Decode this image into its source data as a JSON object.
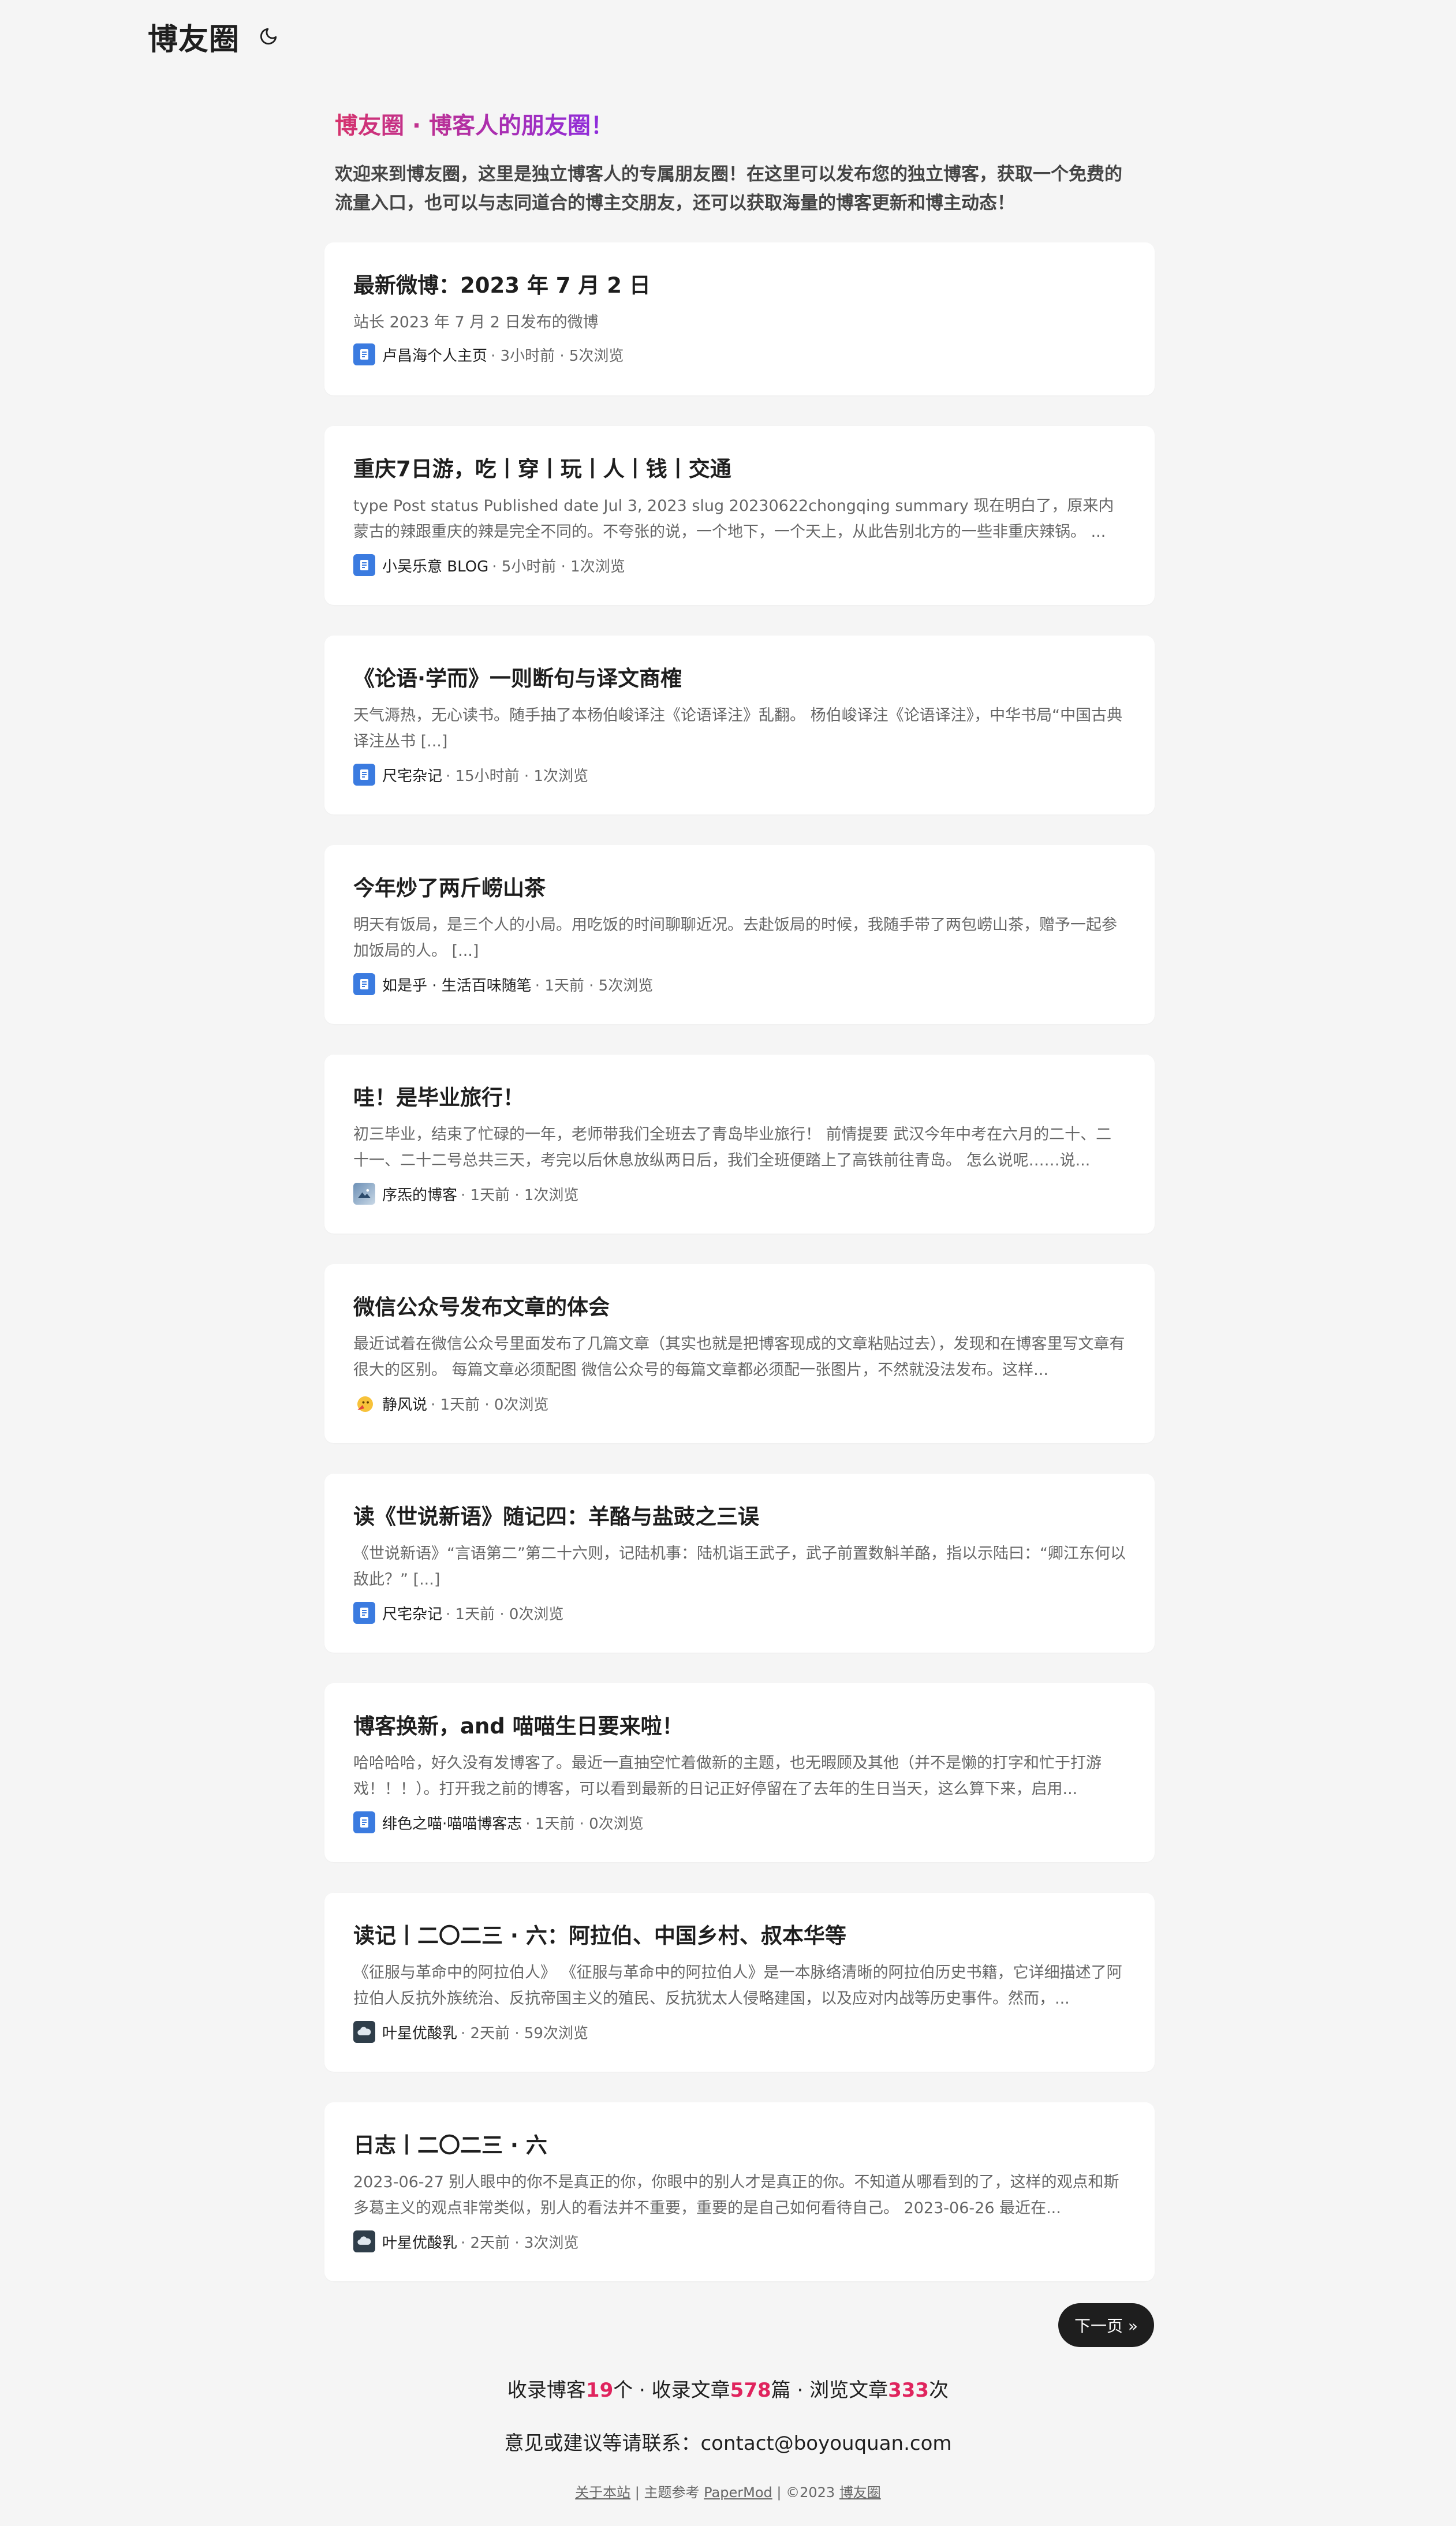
{
  "header": {
    "logo": "博友圈",
    "theme_icon": "moon-icon"
  },
  "intro": {
    "title": "博友圈 · 博客人的朋友圈！",
    "text": "欢迎来到博友圈，这里是独立博客人的专属朋友圈！在这里可以发布您的独立博客，获取一个免费的流量入口，也可以与志同道合的博主交朋友，还可以获取海量的博客更新和博主动态！",
    "gradient": [
      "#d6336c",
      "#8a2be2"
    ]
  },
  "posts": [
    {
      "title": "最新微博：2023 年 7 月 2 日",
      "summary": "站长 2023 年 7 月 2 日发布的微博",
      "blog": "卢昌海个人主页",
      "meta": "· 3小时前 · 5次浏览",
      "avatar": "blue-doc-icon"
    },
    {
      "title": "重庆7日游，吃丨穿丨玩丨人丨钱丨交通",
      "summary": "type Post status Published date Jul 3, 2023 slug 20230622chongqing summary 现在明白了，原来内蒙古的辣跟重庆的辣是完全不同的。不夸张的说，一个地下，一个天上，从此告别北方的一些非重庆辣锅。 ...",
      "blog": "小吴乐意 BLOG",
      "meta": "· 5小时前 · 1次浏览",
      "avatar": "blue-doc-icon"
    },
    {
      "title": "《论语·学而》一则断句与译文商榷",
      "summary": "天气溽热，无心读书。随手抽了本杨伯峻译注《论语译注》乱翻。 杨伯峻译注《论语译注》，中华书局“中国古典译注丛书 [...]",
      "blog": "尺宅杂记",
      "meta": "· 15小时前 · 1次浏览",
      "avatar": "blue-doc-icon"
    },
    {
      "title": "今年炒了两斤崂山茶",
      "summary": "明天有饭局，是三个人的小局。用吃饭的时间聊聊近况。去赴饭局的时候，我随手带了两包崂山茶，赠予一起参加饭局的人。 [...]",
      "blog": "如是乎 · 生活百味随笔",
      "meta": "· 1天前 · 5次浏览",
      "avatar": "blue-doc-icon"
    },
    {
      "title": "哇！是毕业旅行！",
      "summary": "初三毕业，结束了忙碌的一年，老师带我们全班去了青岛毕业旅行！ 前情提要 武汉今年中考在六月的二十、二十一、二十二号总共三天，考完以后休息放纵两日后，我们全班便踏上了高铁前往青岛。 怎么说呢……说...",
      "blog": "序炁的博客",
      "meta": "· 1天前 · 1次浏览",
      "avatar": "photo-icon"
    },
    {
      "title": "微信公众号发布文章的体会",
      "summary": "最近试着在微信公众号里面发布了几篇文章（其实也就是把博客现成的文章粘贴过去），发现和在博客里写文章有很大的区别。 每篇文章必须配图 微信公众号的每篇文章都必须配一张图片，不然就没法发布。这样...",
      "blog": "静风说",
      "meta": "· 1天前 · 0次浏览",
      "avatar": "emoji-icon"
    },
    {
      "title": "读《世说新语》随记四：羊酪与盐豉之三误",
      "summary": "《世说新语》“言语第二”第二十六则，记陆机事：陆机诣王武子，武子前置数斛羊酪，指以示陆曰：“卿江东何以敌此？” [...]",
      "blog": "尺宅杂记",
      "meta": "· 1天前 · 0次浏览",
      "avatar": "blue-doc-icon"
    },
    {
      "title": "博客换新，and 喵喵生日要来啦！",
      "summary": "哈哈哈哈，好久没有发博客了。最近一直抽空忙着做新的主题，也无暇顾及其他（并不是懒的打字和忙于打游戏！！！）。打开我之前的博客，可以看到最新的日记正好停留在了去年的生日当天，这么算下来，启用...",
      "blog": "绯色之喵·喵喵博客志",
      "meta": "· 1天前 · 0次浏览",
      "avatar": "blue-doc-icon"
    },
    {
      "title": "读记丨二〇二三 · 六：阿拉伯、中国乡村、叔本华等",
      "summary": "《征服与革命中的阿拉伯人》 《征服与革命中的阿拉伯人》是一本脉络清晰的阿拉伯历史书籍，它详细描述了阿拉伯人反抗外族统治、反抗帝国主义的殖民、反抗犹太人侵略建国，以及应对内战等历史事件。然而，...",
      "blog": "叶星优酸乳",
      "meta": "· 2天前 · 59次浏览",
      "avatar": "cloud-icon"
    },
    {
      "title": "日志丨二〇二三 · 六",
      "summary": "2023-06-27 别人眼中的你不是真正的你，你眼中的别人才是真正的你。不知道从哪看到的了，这样的观点和斯多葛主义的观点非常类似，别人的看法并不重要，重要的是自己如何看待自己。 2023-06-26 最近在...",
      "blog": "叶星优酸乳",
      "meta": "· 2天前 · 3次浏览",
      "avatar": "cloud-icon"
    }
  ],
  "pager": {
    "next_label": "下一页 »"
  },
  "stats": {
    "prefix1": "收录博客",
    "blogs": "19",
    "suffix1": "个 · 收录文章",
    "articles": "578",
    "suffix2": "篇 · 浏览文章",
    "views": "333",
    "suffix3": "次",
    "accent": "#e0245e"
  },
  "contact": {
    "text": "意见或建议等请联系：contact@boyouquan.com"
  },
  "footer": {
    "about": "关于本站",
    "sep1": " | 主题参考 ",
    "theme": "PaperMod",
    "sep2": " | ©2023 ",
    "site": "博友圈"
  }
}
